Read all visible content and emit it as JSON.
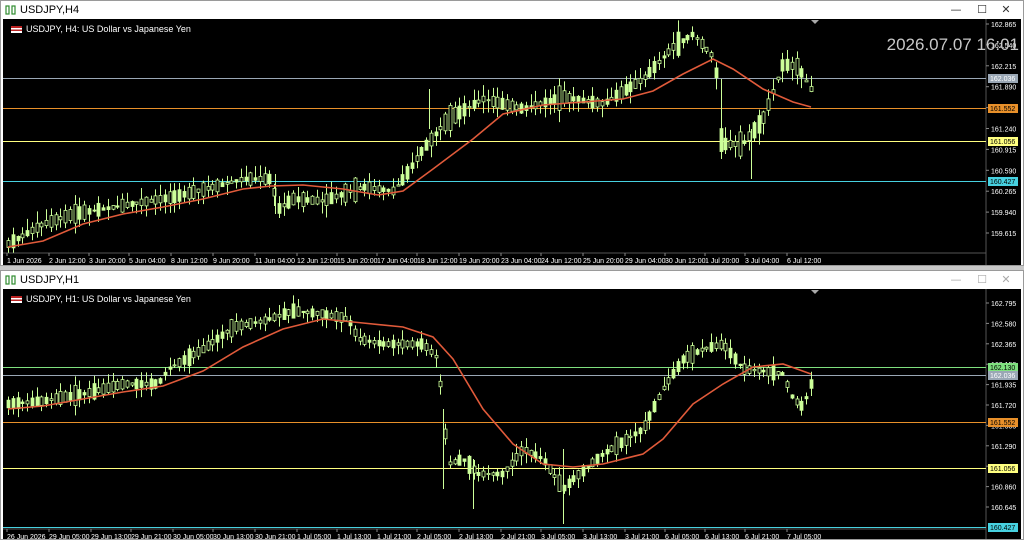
{
  "windows": [
    {
      "id": "h4",
      "title": "USDJPY,H4",
      "header_text": "USDJPY, H4:  US Dollar vs Japanese Yen",
      "datetime": "2026.07.07 16:01",
      "y_labels": [
        "162.865",
        "162.540",
        "162.215",
        "161.890",
        "161.565",
        "161.240",
        "160.915",
        "160.590",
        "160.265",
        "159.940",
        "159.615"
      ],
      "x_labels": [
        "1 Jun 2026",
        "2 Jun 12:00",
        "3 Jun 20:00",
        "5 Jun 04:00",
        "8 Jun 12:00",
        "9 Jun 20:00",
        "11 Jun 04:00",
        "12 Jun 12:00",
        "15 Jun 20:00",
        "17 Jun 04:00",
        "18 Jun 12:00",
        "19 Jun 20:00",
        "23 Jun 04:00",
        "24 Jun 12:00",
        "25 Jun 20:00",
        "29 Jun 04:00",
        "30 Jun 12:00",
        "1 Jul 20:00",
        "3 Jul 04:00",
        "6 Jul 12:00"
      ],
      "price_lines": [
        {
          "label": "162.036",
          "color": "#9aa7b5",
          "text": "#ffffff"
        },
        {
          "label": "161.552",
          "color": "#e8902a",
          "text": "#000000"
        },
        {
          "label": "161.056",
          "color": "#ffff80",
          "text": "#000000"
        },
        {
          "label": "160.427",
          "color": "#47d1e0",
          "text": "#000000"
        }
      ]
    },
    {
      "id": "h1",
      "title": "USDJPY,H1",
      "header_text": "USDJPY, H1:  US Dollar vs Japanese Yen",
      "y_labels": [
        "162.795",
        "162.580",
        "162.365",
        "162.150",
        "161.935",
        "161.720",
        "161.505",
        "161.290",
        "161.075",
        "160.860",
        "160.645"
      ],
      "x_labels": [
        "26 Jun 2026",
        "29 Jun 05:00",
        "29 Jun 13:00",
        "29 Jun 21:00",
        "30 Jun 05:00",
        "30 Jun 13:00",
        "30 Jun 21:00",
        "1 Jul 05:00",
        "1 Jul 13:00",
        "1 Jul 21:00",
        "2 Jul 05:00",
        "2 Jul 13:00",
        "2 Jul 21:00",
        "3 Jul 05:00",
        "3 Jul 13:00",
        "3 Jul 21:00",
        "6 Jul 05:00",
        "6 Jul 13:00",
        "6 Jul 21:00",
        "7 Jul 05:00"
      ],
      "price_lines": [
        {
          "label": "162.130",
          "color": "#7fe07f",
          "text": "#000000"
        },
        {
          "label": "162.036",
          "color": "#9aa7b5",
          "text": "#ffffff"
        },
        {
          "label": "161.552",
          "color": "#e8902a",
          "text": "#000000"
        },
        {
          "label": "161.056",
          "color": "#ffff80",
          "text": "#000000"
        },
        {
          "label": "160.427",
          "color": "#47d1e0",
          "text": "#000000"
        }
      ]
    }
  ],
  "colors": {
    "background": "#000000",
    "candle": "#ccff99",
    "moving_average": "#e05a3a",
    "axis_text": "#ffffff",
    "grid": "#2a2a2a"
  },
  "icons": {
    "window": "chart-window-icon",
    "minimize": "minimize-icon",
    "maximize": "maximize-icon",
    "close": "close-icon"
  }
}
